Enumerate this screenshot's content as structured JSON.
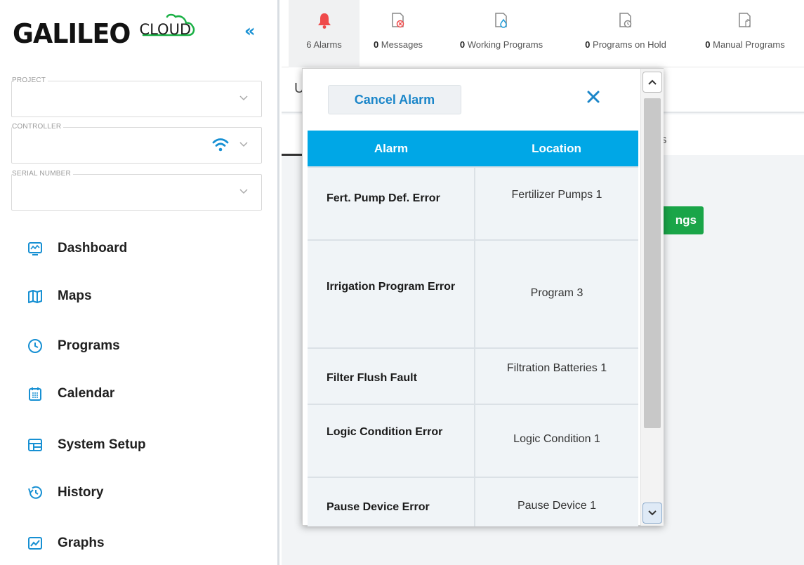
{
  "brand": {
    "name": "GALILEO",
    "suffix": "CLOUD",
    "collapse": "«",
    "accent": "#1790d3"
  },
  "filters": [
    {
      "label": "PROJECT",
      "value": ""
    },
    {
      "label": "CONTROLLER",
      "value": ""
    },
    {
      "label": "SERIAL NUMBER",
      "value": ""
    }
  ],
  "nav": [
    {
      "label": "Dashboard",
      "icon": "dashboard-icon"
    },
    {
      "label": "Maps",
      "icon": "map-icon"
    },
    {
      "label": "Programs",
      "icon": "clock-icon"
    },
    {
      "label": "Calendar",
      "icon": "calendar-icon"
    },
    {
      "label": "System Setup",
      "icon": "setup-icon"
    },
    {
      "label": "History",
      "icon": "history-icon"
    },
    {
      "label": "Graphs",
      "icon": "graph-icon"
    }
  ],
  "topbar": [
    {
      "count": "6",
      "label": "Alarms",
      "icon": "bell-icon"
    },
    {
      "count": "0",
      "label": "Messages",
      "icon": "message-error-icon"
    },
    {
      "count": "0",
      "label": "Working Programs",
      "icon": "working-program-icon"
    },
    {
      "count": "0",
      "label": "Programs on Hold",
      "icon": "program-hold-icon"
    },
    {
      "count": "0",
      "label": "Manual Programs",
      "icon": "manual-program-icon"
    }
  ],
  "main": {
    "header_letter": "U",
    "tab_fragment": "s",
    "settings_fragment": "ngs"
  },
  "popup": {
    "cancel_label": "Cancel Alarm",
    "columns": [
      "Alarm",
      "Location"
    ],
    "rows": [
      {
        "alarm": "Fert. Pump Def. Error",
        "location": "Fertilizer Pumps 1"
      },
      {
        "alarm": "Irrigation Program Error",
        "location": "Program 3"
      },
      {
        "alarm": "Filter Flush Fault",
        "location": "Filtration Batteries 1"
      },
      {
        "alarm": "Logic Condition Error",
        "location": "Logic Condition 1"
      },
      {
        "alarm": "Pause Device Error",
        "location": "Pause Device 1"
      }
    ]
  },
  "colors": {
    "header_blue": "#00a7e6",
    "alarm_red": "#ef4a4a",
    "green": "#1aa548",
    "link_blue": "#1b86c9"
  }
}
